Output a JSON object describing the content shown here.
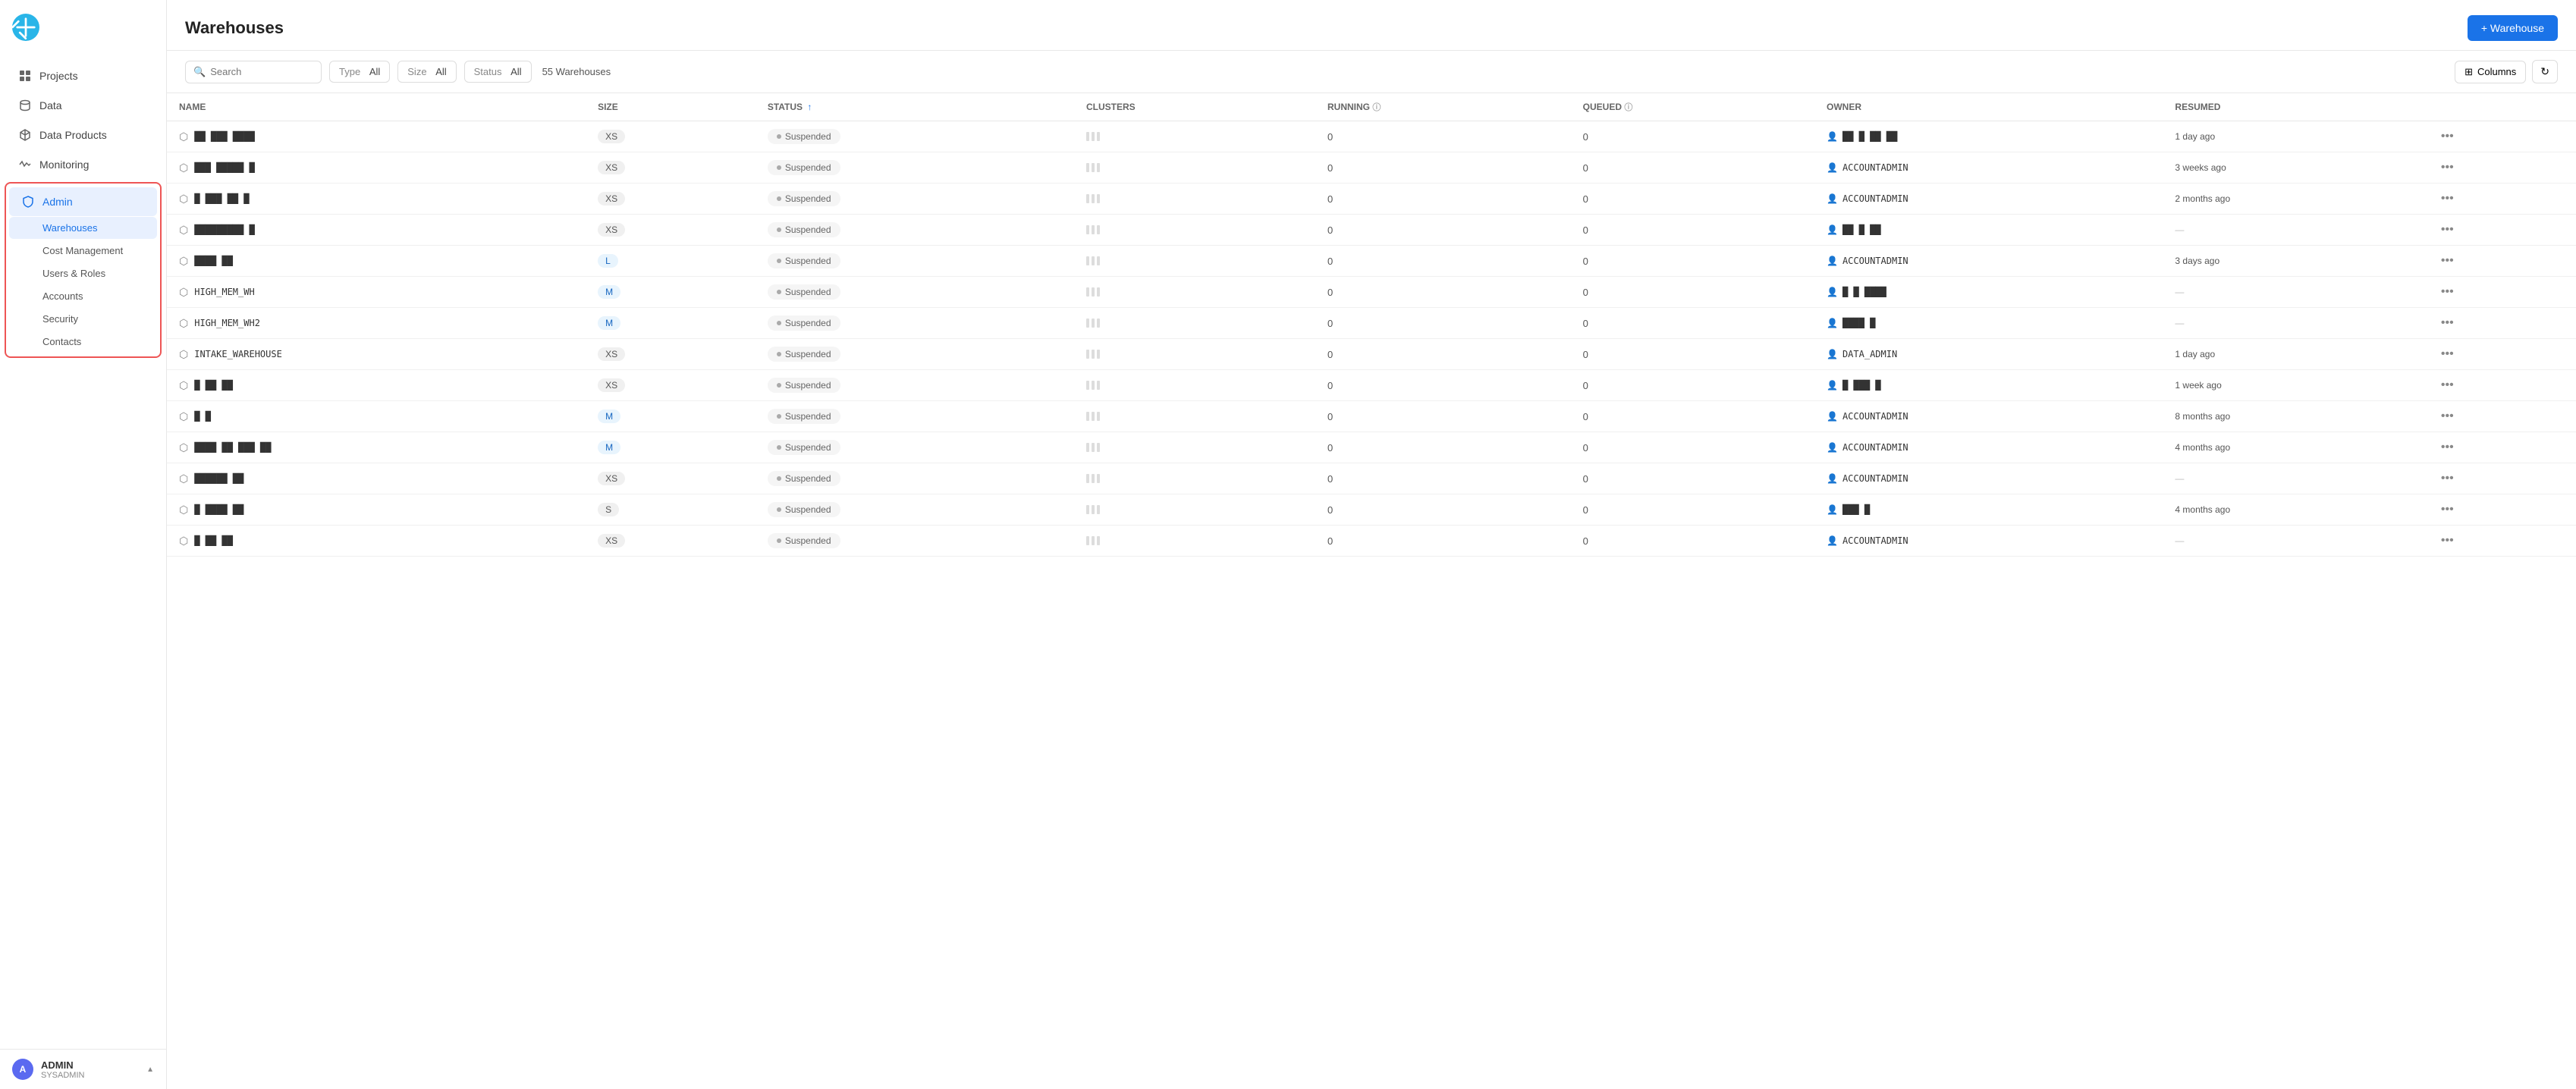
{
  "app": {
    "title": "Snowflake"
  },
  "sidebar": {
    "nav_items": [
      {
        "id": "projects",
        "label": "Projects",
        "icon": "grid"
      },
      {
        "id": "data",
        "label": "Data",
        "icon": "cylinder"
      },
      {
        "id": "data-products",
        "label": "Data Products",
        "icon": "box"
      },
      {
        "id": "monitoring",
        "label": "Monitoring",
        "icon": "activity"
      },
      {
        "id": "admin",
        "label": "Admin",
        "icon": "shield"
      }
    ],
    "admin_sub_items": [
      {
        "id": "warehouses",
        "label": "Warehouses",
        "active": true
      },
      {
        "id": "cost-management",
        "label": "Cost Management"
      },
      {
        "id": "users-roles",
        "label": "Users & Roles"
      },
      {
        "id": "accounts",
        "label": "Accounts"
      },
      {
        "id": "security",
        "label": "Security"
      },
      {
        "id": "contacts",
        "label": "Contacts"
      }
    ],
    "user": {
      "name": "ADMIN",
      "role": "SYSADMIN",
      "avatar_letter": "A"
    }
  },
  "header": {
    "title": "Warehouses",
    "add_button": "+ Warehouse"
  },
  "toolbar": {
    "search_placeholder": "Search",
    "type_label": "Type",
    "type_value": "All",
    "size_label": "Size",
    "size_value": "All",
    "status_label": "Status",
    "status_value": "All",
    "warehouse_count": "55 Warehouses",
    "columns_button": "Columns"
  },
  "table": {
    "columns": [
      {
        "id": "name",
        "label": "NAME"
      },
      {
        "id": "size",
        "label": "SIZE"
      },
      {
        "id": "status",
        "label": "STATUS",
        "sortable": true,
        "sort_dir": "asc"
      },
      {
        "id": "clusters",
        "label": "CLUSTERS"
      },
      {
        "id": "running",
        "label": "RUNNING",
        "has_info": true
      },
      {
        "id": "queued",
        "label": "QUEUED",
        "has_info": true
      },
      {
        "id": "owner",
        "label": "OWNER"
      },
      {
        "id": "resumed",
        "label": "RESUMED"
      }
    ],
    "rows": [
      {
        "name": "██ ███ ████",
        "size": "XS",
        "status": "Suspended",
        "running": "0",
        "queued": "0",
        "owner": "██ █ ██ ██",
        "resumed": "1 day ago"
      },
      {
        "name": "███ █████ █",
        "size": "XS",
        "status": "Suspended",
        "running": "0",
        "queued": "0",
        "owner": "ACCOUNTADMIN",
        "resumed": "3 weeks ago"
      },
      {
        "name": "█ ███ ██ █",
        "size": "XS",
        "status": "Suspended",
        "running": "0",
        "queued": "0",
        "owner": "ACCOUNTADMIN",
        "resumed": "2 months ago"
      },
      {
        "name": "█████████ █",
        "size": "XS",
        "status": "Suspended",
        "running": "0",
        "queued": "0",
        "owner": "██ █ ██",
        "resumed": "—"
      },
      {
        "name": "████ ██",
        "size": "L",
        "status": "Suspended",
        "running": "0",
        "queued": "0",
        "owner": "ACCOUNTADMIN",
        "resumed": "3 days ago"
      },
      {
        "name": "HIGH_MEM_WH",
        "size": "M",
        "status": "Suspended",
        "running": "0",
        "queued": "0",
        "owner": "█ █ ████",
        "resumed": "—"
      },
      {
        "name": "HIGH_MEM_WH2",
        "size": "M",
        "status": "Suspended",
        "running": "0",
        "queued": "0",
        "owner": "████ █",
        "resumed": "—"
      },
      {
        "name": "INTAKE_WAREHOUSE",
        "size": "XS",
        "status": "Suspended",
        "running": "0",
        "queued": "0",
        "owner": "DATA_ADMIN",
        "resumed": "1 day ago"
      },
      {
        "name": "█ ██ ██",
        "size": "XS",
        "status": "Suspended",
        "running": "0",
        "queued": "0",
        "owner": "█ ███ █",
        "resumed": "1 week ago"
      },
      {
        "name": "█ █",
        "size": "M",
        "status": "Suspended",
        "running": "0",
        "queued": "0",
        "owner": "ACCOUNTADMIN",
        "resumed": "8 months ago"
      },
      {
        "name": "████ ██ ███ ██",
        "size": "M",
        "status": "Suspended",
        "running": "0",
        "queued": "0",
        "owner": "ACCOUNTADMIN",
        "resumed": "4 months ago"
      },
      {
        "name": "██████ ██",
        "size": "XS",
        "status": "Suspended",
        "running": "0",
        "queued": "0",
        "owner": "ACCOUNTADMIN",
        "resumed": "—"
      },
      {
        "name": "█ ████ ██",
        "size": "S",
        "status": "Suspended",
        "running": "0",
        "queued": "0",
        "owner": "███ █",
        "resumed": "4 months ago"
      },
      {
        "name": "█ ██ ██",
        "size": "XS",
        "status": "Suspended",
        "running": "0",
        "queued": "0",
        "owner": "ACCOUNTADMIN",
        "resumed": "—"
      }
    ]
  }
}
